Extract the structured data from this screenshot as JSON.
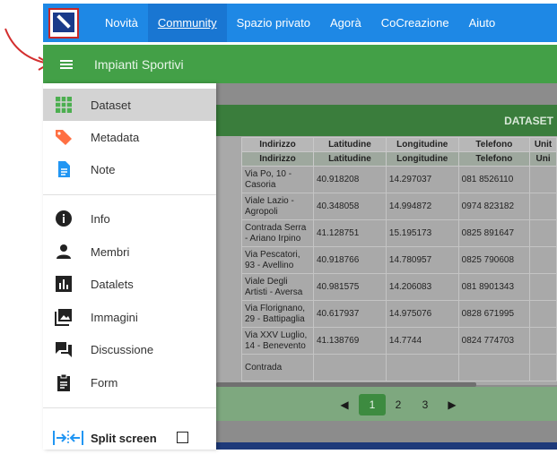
{
  "topnav": {
    "links": [
      "Novità",
      "Community",
      "Spazio privato",
      "Agorà",
      "CoCreazione",
      "Aiuto"
    ]
  },
  "header": {
    "title": "Impianti Sportivi"
  },
  "sidebar": {
    "items": [
      {
        "label": "Dataset",
        "icon": "grid-icon"
      },
      {
        "label": "Metadata",
        "icon": "tag-icon"
      },
      {
        "label": "Note",
        "icon": "document-icon"
      },
      {
        "label": "Info",
        "icon": "info-icon"
      },
      {
        "label": "Membri",
        "icon": "person-icon"
      },
      {
        "label": "Datalets",
        "icon": "bar-chart-icon"
      },
      {
        "label": "Immagini",
        "icon": "image-icon"
      },
      {
        "label": "Discussione",
        "icon": "chat-icon"
      },
      {
        "label": "Form",
        "icon": "clipboard-icon"
      }
    ],
    "split_screen": "Split screen"
  },
  "dataset": {
    "title": "DATASET",
    "headers": [
      "Indirizzo",
      "Latitudine",
      "Longitudine",
      "Telefono",
      "Unit"
    ],
    "subheaders": [
      "Indirizzo",
      "Latitudine",
      "Longitudine",
      "Telefono",
      "Uni"
    ],
    "rows": [
      [
        "Via Po, 10 - Casoria",
        "40.918208",
        "14.297037",
        "081 8526110"
      ],
      [
        "Viale Lazio - Agropoli",
        "40.348058",
        "14.994872",
        "0974 823182"
      ],
      [
        "Contrada Serra - Ariano Irpino",
        "41.128751",
        "15.195173",
        "0825 891647"
      ],
      [
        "Via Pescatori, 93 - Avellino",
        "40.918766",
        "14.780957",
        "0825 790608"
      ],
      [
        "Viale Degli Artisti - Aversa",
        "40.981575",
        "14.206083",
        "081 8901343"
      ],
      [
        "Via Florignano, 29 - Battipaglia",
        "40.617937",
        "14.975076",
        "0828 671995"
      ],
      [
        "Via XXV Luglio, 14 - Benevento",
        "41.138769",
        "14.7744",
        "0824 774703"
      ],
      [
        "Contrada",
        "",
        "",
        ""
      ]
    ]
  },
  "pagination": {
    "prev": "◀",
    "pages": [
      "1",
      "2",
      "3"
    ],
    "next": "▶",
    "current": "1"
  },
  "colors": {
    "nav": "#1e88e5",
    "header": "#43a047",
    "accent": "#3d8b40"
  }
}
